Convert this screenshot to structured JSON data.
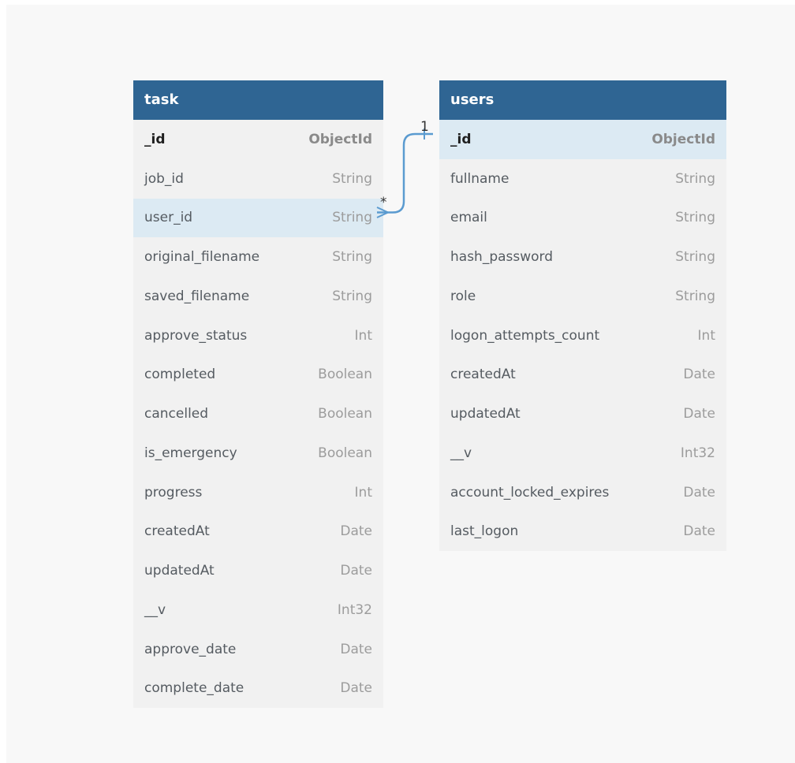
{
  "tables": [
    {
      "name": "task",
      "fields": [
        {
          "name": "_id",
          "type": "ObjectId",
          "primary": true
        },
        {
          "name": "job_id",
          "type": "String"
        },
        {
          "name": "user_id",
          "type": "String",
          "highlight": true
        },
        {
          "name": "original_filename",
          "type": "String"
        },
        {
          "name": "saved_filename",
          "type": "String"
        },
        {
          "name": "approve_status",
          "type": "Int"
        },
        {
          "name": "completed",
          "type": "Boolean"
        },
        {
          "name": "cancelled",
          "type": "Boolean"
        },
        {
          "name": "is_emergency",
          "type": "Boolean"
        },
        {
          "name": "progress",
          "type": "Int"
        },
        {
          "name": "createdAt",
          "type": "Date"
        },
        {
          "name": "updatedAt",
          "type": "Date"
        },
        {
          "name": "__v",
          "type": "Int32"
        },
        {
          "name": "approve_date",
          "type": "Date"
        },
        {
          "name": "complete_date",
          "type": "Date"
        }
      ]
    },
    {
      "name": "users",
      "fields": [
        {
          "name": "_id",
          "type": "ObjectId",
          "primary": true,
          "highlight": true
        },
        {
          "name": "fullname",
          "type": "String"
        },
        {
          "name": "email",
          "type": "String"
        },
        {
          "name": "hash_password",
          "type": "String"
        },
        {
          "name": "role",
          "type": "String"
        },
        {
          "name": "logon_attempts_count",
          "type": "Int"
        },
        {
          "name": "createdAt",
          "type": "Date"
        },
        {
          "name": "updatedAt",
          "type": "Date"
        },
        {
          "name": "__v",
          "type": "Int32"
        },
        {
          "name": "account_locked_expires",
          "type": "Date"
        },
        {
          "name": "last_logon",
          "type": "Date"
        }
      ]
    }
  ],
  "relation": {
    "from": "task.user_id",
    "to": "users._id",
    "from_cardinality": "*",
    "to_cardinality": "1",
    "color": "#5b9bd0"
  },
  "colors": {
    "header": "#2f6593",
    "table_bg": "#f1f1f1",
    "highlight_row": "#dceaf3",
    "canvas": "#f8f8f8"
  }
}
